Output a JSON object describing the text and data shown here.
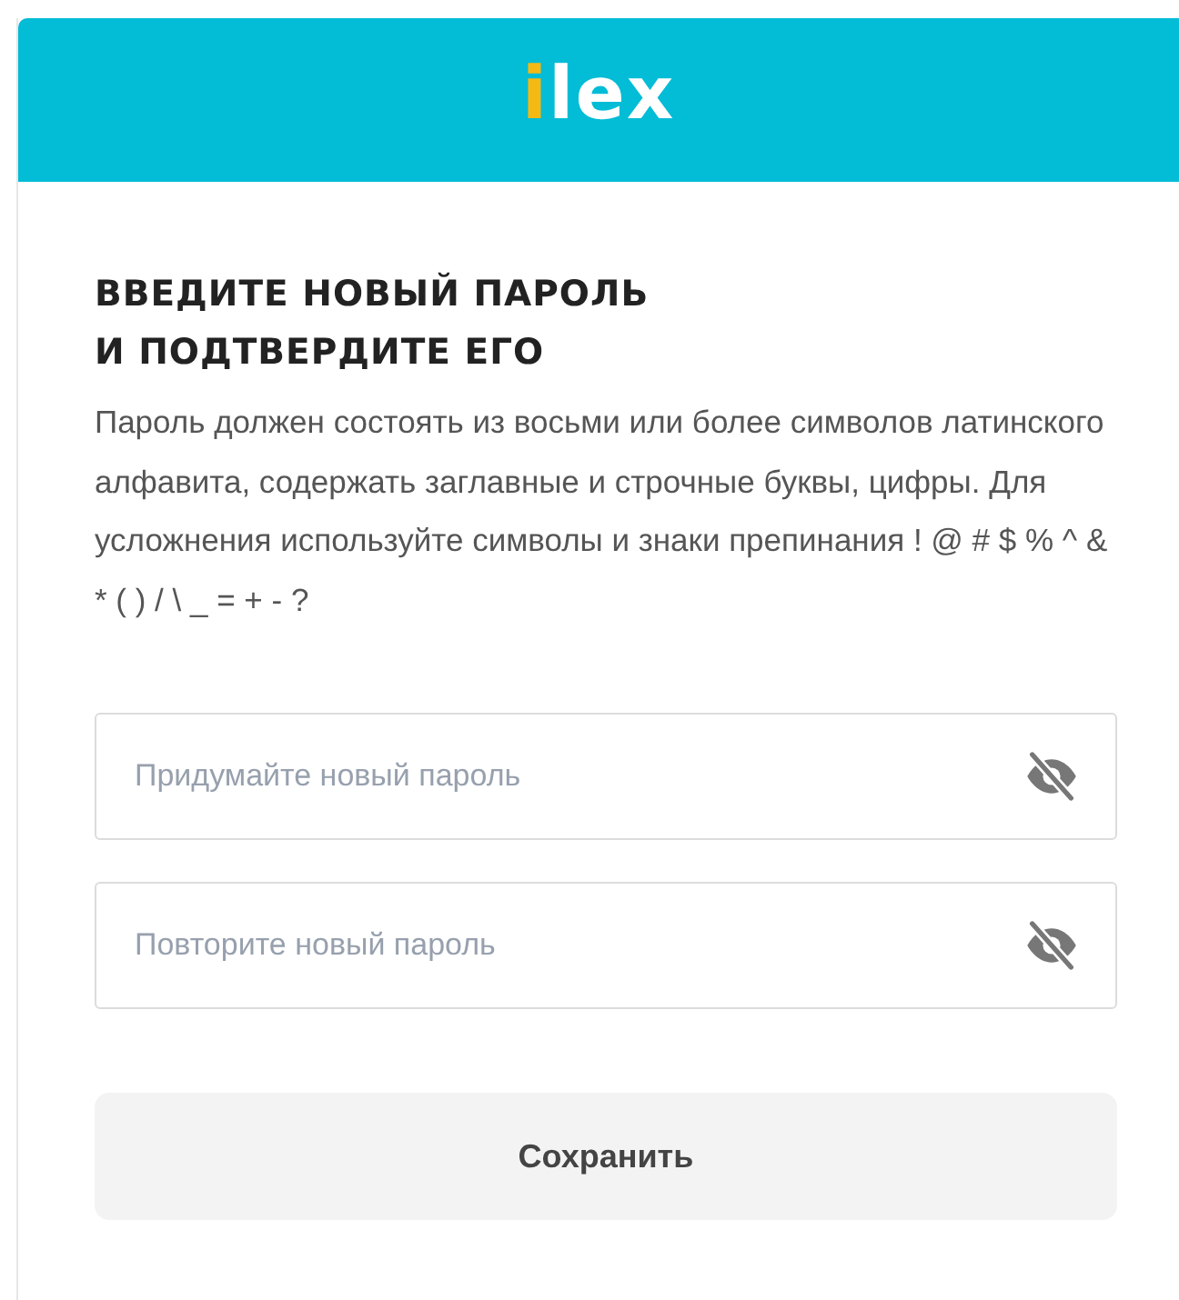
{
  "header": {
    "logo_accent": "i",
    "logo_rest": "lex"
  },
  "title_lines": [
    "ВВЕДИТЕ НОВЫЙ ПАРОЛЬ",
    "И ПОДТВЕРДИТЕ ЕГО"
  ],
  "description": "Пароль должен состоять из восьми или более символов латинского алфавита, содержать заглавные и строчные буквы, цифры. Для усложнения используйте символы и знаки препинания ! @ # $ % ^ & * ( ) / \\ _ = + - ?",
  "fields": [
    {
      "placeholder": "Придумайте новый пароль",
      "hidden": true
    },
    {
      "placeholder": "Повторите новый пароль",
      "hidden": true
    }
  ],
  "button": "Сохранить"
}
